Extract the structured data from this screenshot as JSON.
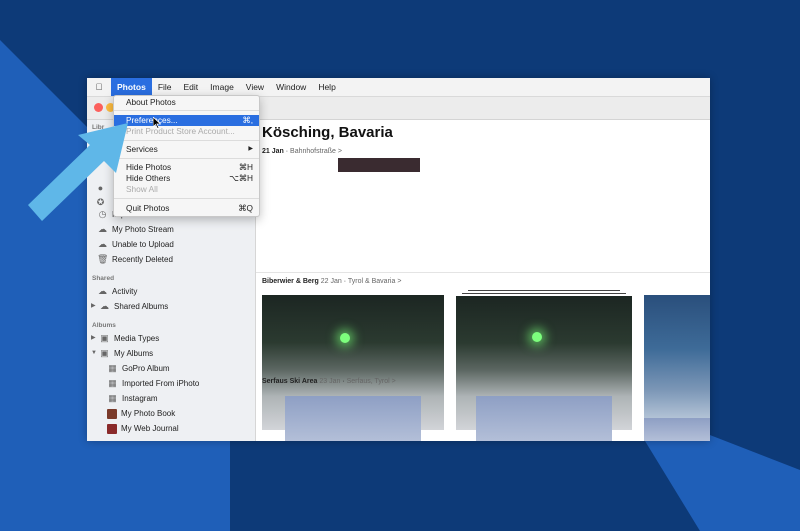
{
  "menubar": {
    "items": [
      "Photos",
      "File",
      "Edit",
      "Image",
      "View",
      "Window",
      "Help"
    ],
    "active": "Photos"
  },
  "dropdown": {
    "about": "About Photos",
    "preferences": "Preferences...",
    "preferences_shortcut": "⌘,",
    "print_store": "Print Product Store Account...",
    "services": "Services",
    "services_arrow": "▶",
    "hide_photos": "Hide Photos",
    "hide_photos_shortcut": "⌘H",
    "hide_others": "Hide Others",
    "hide_others_shortcut": "⌥⌘H",
    "show_all": "Show All",
    "quit": "Quit Photos",
    "quit_shortcut": "⌘Q"
  },
  "sidebar": {
    "library_label": "Libr",
    "imports": "Imports",
    "items": [
      "My Photo Stream",
      "Unable to Upload",
      "Recently Deleted"
    ],
    "shared_label": "Shared",
    "shared_items": [
      "Activity",
      "Shared Albums"
    ],
    "albums_label": "Albums",
    "album_items": [
      "Media Types",
      "My Albums"
    ],
    "my_albums_children": [
      "GoPro Album",
      "Imported From iPhoto",
      "Instagram",
      "My Photo Book",
      "My Web Journal"
    ]
  },
  "main": {
    "title": "Kösching, Bavaria",
    "date": "21 Jan",
    "location": "Bahnhofstraße",
    "chevron": ">",
    "moments": [
      {
        "name": "Biberwier & Berg",
        "date": "22 Jan",
        "location": "Tyrol & Bavaria"
      },
      {
        "name": "Serfaus Ski Area",
        "date": "23 Jan",
        "location": "Serfaus, Tyrol"
      }
    ]
  },
  "colors": {
    "accent": "#2a6ee0",
    "arrow": "#5fb7e8",
    "background_dark": "#0d3a78",
    "background_light": "#1f5fb8"
  }
}
